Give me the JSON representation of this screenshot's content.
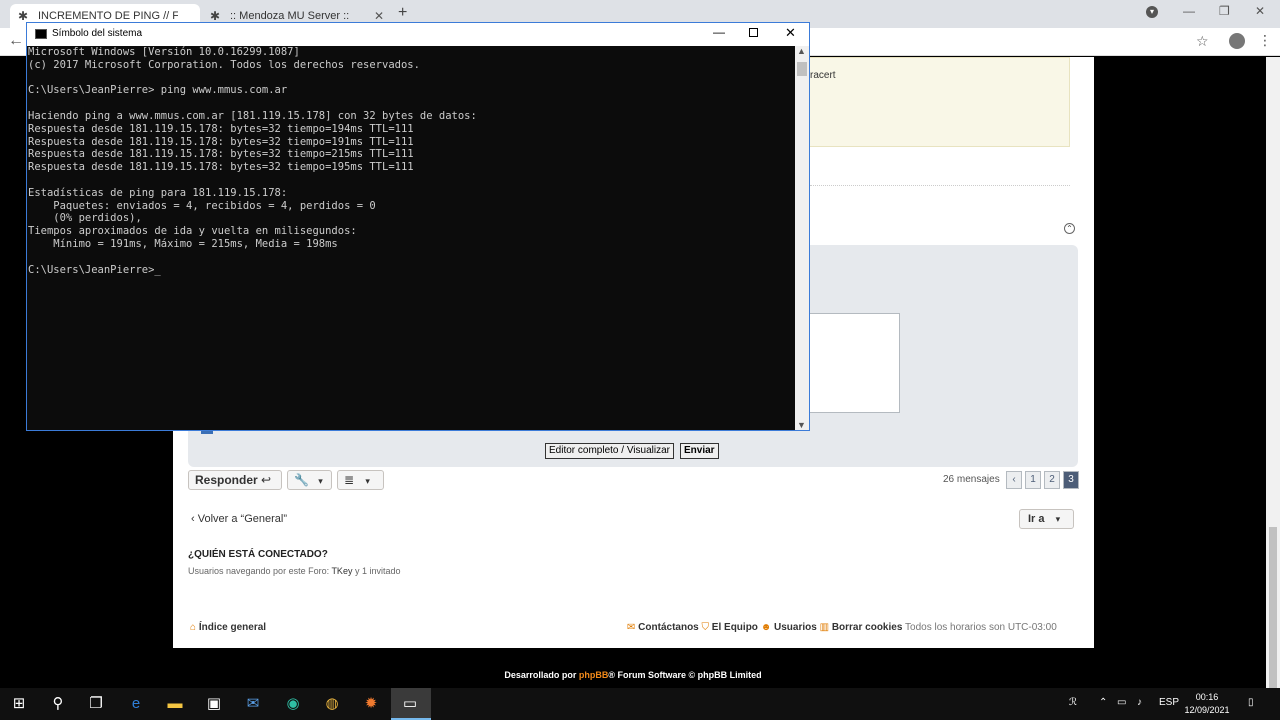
{
  "browser": {
    "tabs": [
      {
        "title": "INCREMENTO DE PING // FIBERT",
        "active": true
      },
      {
        "title": ":: Mendoza MU Server ::",
        "active": false
      }
    ],
    "new_tab": "+"
  },
  "page": {
    "yellow_text": "racert",
    "preview_button": "Editor completo / Visualizar",
    "send_button": "Enviar",
    "reply_button": "Responder",
    "post_count": "26 mensajes",
    "pages": [
      "1",
      "2",
      "3"
    ],
    "current_page": "3",
    "back_link": "Volver a “General”",
    "goto_label": "Ir a",
    "who_title": "¿QUIÉN ESTÁ CONECTADO?",
    "who_prefix": "Usuarios navegando por este Foro:",
    "who_user": "TKey",
    "who_suffix": "y 1 invitado",
    "footer_index": "Índice general",
    "footer_contact": "Contáctanos",
    "footer_team": "El Equipo",
    "footer_users": "Usuarios",
    "footer_cookies": "Borrar cookies",
    "footer_tz": "Todos los horarios son UTC-03:00",
    "powered_prefix": "Desarrollado por",
    "powered_brand": "phpBB",
    "powered_suffix": "® Forum Software © phpBB Limited"
  },
  "cmd": {
    "title": "Símbolo del sistema",
    "output": "Microsoft Windows [Versión 10.0.16299.1087]\n(c) 2017 Microsoft Corporation. Todos los derechos reservados.\n\nC:\\Users\\JeanPierre> ping www.mmus.com.ar\n\nHaciendo ping a www.mmus.com.ar [181.119.15.178] con 32 bytes de datos:\nRespuesta desde 181.119.15.178: bytes=32 tiempo=194ms TTL=111\nRespuesta desde 181.119.15.178: bytes=32 tiempo=191ms TTL=111\nRespuesta desde 181.119.15.178: bytes=32 tiempo=215ms TTL=111\nRespuesta desde 181.119.15.178: bytes=32 tiempo=195ms TTL=111\n\nEstadísticas de ping para 181.119.15.178:\n    Paquetes: enviados = 4, recibidos = 4, perdidos = 0\n    (0% perdidos),\nTiempos aproximados de ida y vuelta en milisegundos:\n    Mínimo = 191ms, Máximo = 215ms, Media = 198ms\n\nC:\\Users\\JeanPierre>_"
  },
  "taskbar": {
    "lang": "ESP",
    "time": "00:16",
    "date": "12/09/2021"
  }
}
